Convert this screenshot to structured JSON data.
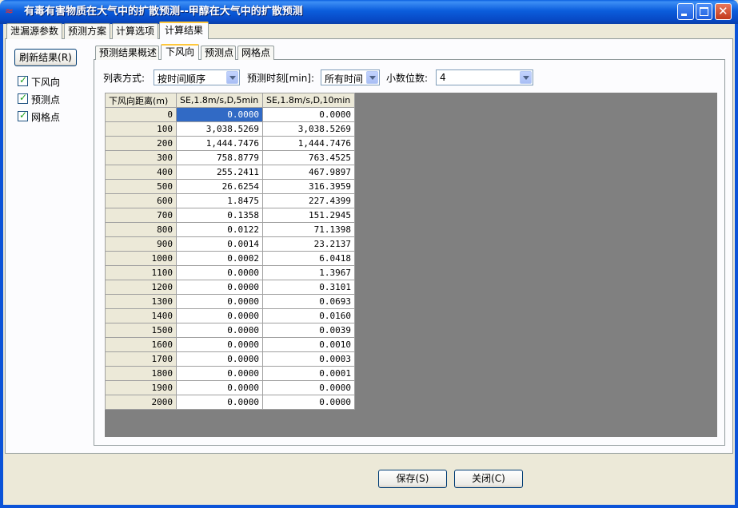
{
  "window": {
    "title": "有毒有害物质在大气中的扩散预测--甲醇在大气中的扩散预测"
  },
  "main_tabs": [
    "泄漏源参数",
    "预测方案",
    "计算选项",
    "计算结果"
  ],
  "sidebar": {
    "refresh_label": "刷新结果(R)",
    "checks": [
      {
        "label": "下风向",
        "checked": true
      },
      {
        "label": "预测点",
        "checked": true
      },
      {
        "label": "网格点",
        "checked": true
      }
    ]
  },
  "sub_tabs": [
    "预测结果概述",
    "下风向",
    "预测点",
    "网格点"
  ],
  "options": {
    "list_mode_label": "列表方式:",
    "list_mode_value": "按时间顺序",
    "time_label": "预测时刻[min]:",
    "time_value": "所有时间",
    "decimals_label": "小数位数:",
    "decimals_value": "4"
  },
  "table": {
    "headers": [
      "下风向距离(m)",
      "SE,1.8m/s,D,5min",
      "SE,1.8m/s,D,10min"
    ],
    "rows": [
      [
        "0",
        "0.0000",
        "0.0000"
      ],
      [
        "100",
        "3,038.5269",
        "3,038.5269"
      ],
      [
        "200",
        "1,444.7476",
        "1,444.7476"
      ],
      [
        "300",
        "758.8779",
        "763.4525"
      ],
      [
        "400",
        "255.2411",
        "467.9897"
      ],
      [
        "500",
        "26.6254",
        "316.3959"
      ],
      [
        "600",
        "1.8475",
        "227.4399"
      ],
      [
        "700",
        "0.1358",
        "151.2945"
      ],
      [
        "800",
        "0.0122",
        "71.1398"
      ],
      [
        "900",
        "0.0014",
        "23.2137"
      ],
      [
        "1000",
        "0.0002",
        "6.0418"
      ],
      [
        "1100",
        "0.0000",
        "1.3967"
      ],
      [
        "1200",
        "0.0000",
        "0.3101"
      ],
      [
        "1300",
        "0.0000",
        "0.0693"
      ],
      [
        "1400",
        "0.0000",
        "0.0160"
      ],
      [
        "1500",
        "0.0000",
        "0.0039"
      ],
      [
        "1600",
        "0.0000",
        "0.0010"
      ],
      [
        "1700",
        "0.0000",
        "0.0003"
      ],
      [
        "1800",
        "0.0000",
        "0.0001"
      ],
      [
        "1900",
        "0.0000",
        "0.0000"
      ],
      [
        "2000",
        "0.0000",
        "0.0000"
      ]
    ]
  },
  "footer": {
    "save_label": "保存(S)",
    "close_label": "关闭(C)"
  },
  "colors": {
    "titlebar": "#0B5DDC",
    "selection": "#316AC5",
    "grid_bg": "#808080"
  }
}
